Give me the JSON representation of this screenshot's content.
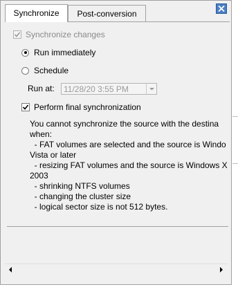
{
  "tabs": [
    {
      "label": "Synchronize",
      "active": true
    },
    {
      "label": "Post-conversion",
      "active": false
    }
  ],
  "close_icon": "close-icon",
  "sync_changes": {
    "label": "Synchronize changes",
    "checked": true,
    "enabled": false
  },
  "run_immediately": {
    "label": "Run immediately",
    "selected": true
  },
  "schedule": {
    "label": "Schedule",
    "selected": false
  },
  "run_at": {
    "label": "Run at:",
    "value": "11/28/20 3:55 PM",
    "enabled": false
  },
  "final_sync": {
    "label": "Perform final synchronization",
    "checked": true
  },
  "message": "You cannot synchronize the source with the destina\nwhen:\n  - FAT volumes are selected and the source is Windo\nVista or later\n  - resizing FAT volumes and the source is Windows X\n2003\n  - shrinking NTFS volumes\n  - changing the cluster size\n  - logical sector size is not 512 bytes."
}
